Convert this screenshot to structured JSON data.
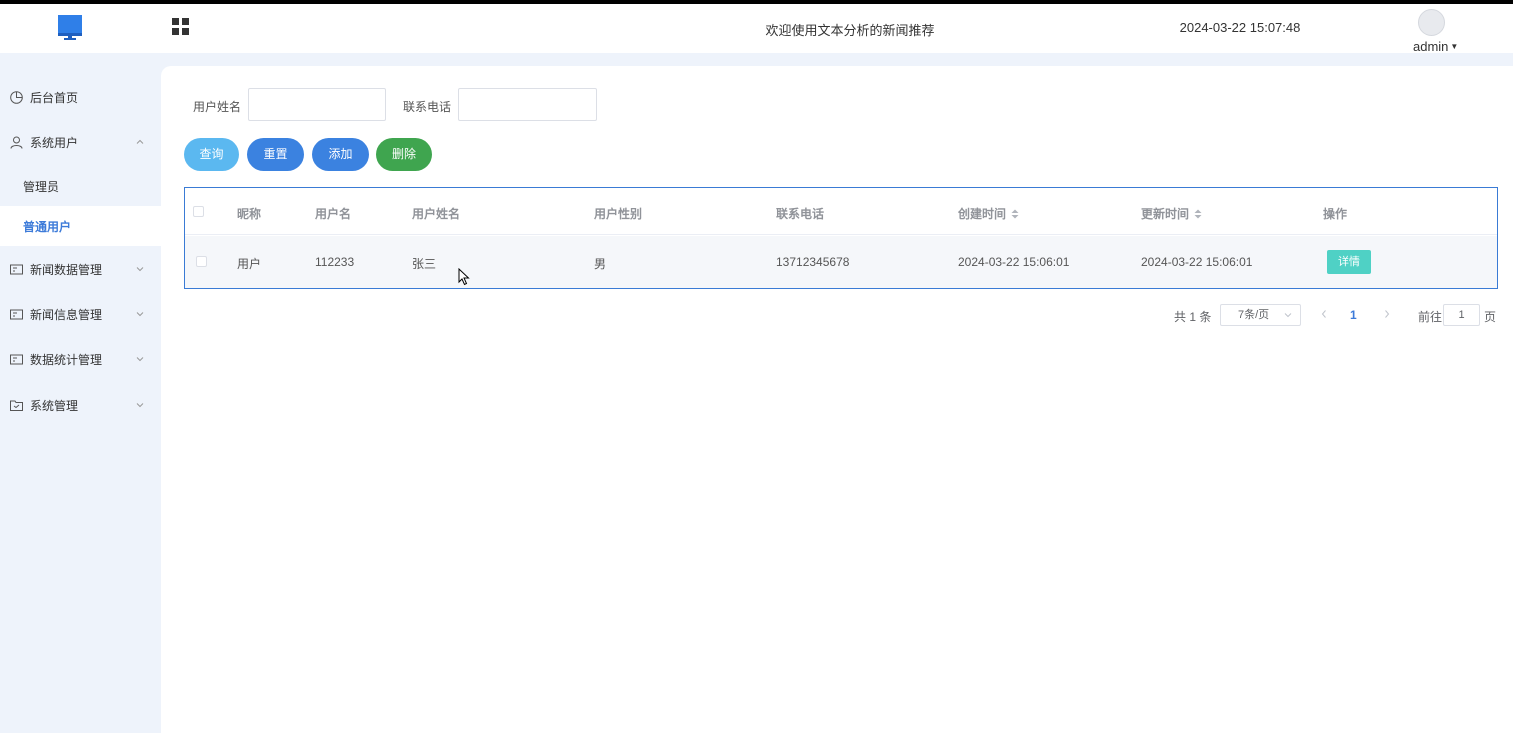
{
  "header": {
    "title": "欢迎使用文本分析的新闻推荐",
    "datetime": "2024-03-22 15:07:48",
    "user": "admin"
  },
  "sidebar": {
    "items": [
      {
        "label": "后台首页",
        "icon": "clock-icon"
      },
      {
        "label": "系统用户",
        "icon": "user-icon",
        "expanded": true,
        "children": [
          {
            "label": "管理员"
          },
          {
            "label": "普通用户",
            "active": true
          }
        ]
      },
      {
        "label": "新闻数据管理",
        "icon": "card-icon"
      },
      {
        "label": "新闻信息管理",
        "icon": "card-icon"
      },
      {
        "label": "数据统计管理",
        "icon": "card-icon"
      },
      {
        "label": "系统管理",
        "icon": "folder-icon"
      }
    ]
  },
  "search": {
    "name_label": "用户姓名",
    "name_value": "",
    "phone_label": "联系电话",
    "phone_value": ""
  },
  "buttons": {
    "query": "查询",
    "reset": "重置",
    "add": "添加",
    "delete": "删除"
  },
  "colors": {
    "query": "#5bb8f0",
    "reset": "#3b82e0",
    "add": "#3b82e0",
    "delete": "#3fa54f",
    "detail": "#4fd1c5",
    "accent": "#3d7bd9"
  },
  "table": {
    "columns": [
      "昵称",
      "用户名",
      "用户姓名",
      "用户性别",
      "联系电话",
      "创建时间",
      "更新时间",
      "操作"
    ],
    "rows": [
      {
        "nickname": "用户",
        "username": "112233",
        "realname": "张三",
        "gender": "男",
        "phone": "13712345678",
        "created": "2024-03-22 15:06:01",
        "updated": "2024-03-22 15:06:01",
        "action": "详情"
      }
    ]
  },
  "pagination": {
    "total": "共 1 条",
    "page_size": "7条/页",
    "current": "1",
    "goto_label": "前往",
    "goto_value": "1",
    "page_unit": "页"
  }
}
